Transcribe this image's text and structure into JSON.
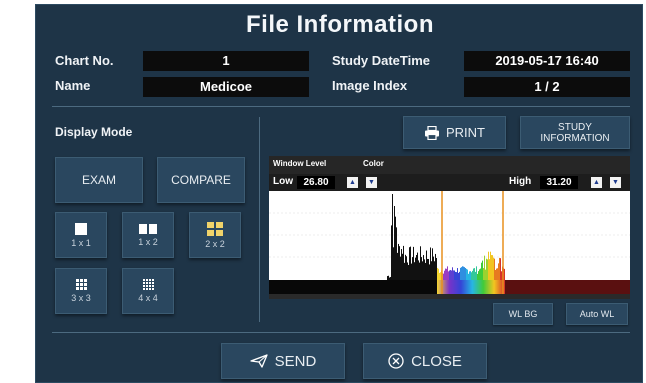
{
  "dialog": {
    "title": "File Information"
  },
  "info": {
    "chart_no_label": "Chart No.",
    "chart_no_value": "1",
    "name_label": "Name",
    "name_value": "Medicoe",
    "study_datetime_label": "Study DateTime",
    "study_datetime_value": "2019-05-17 16:40",
    "image_index_label": "Image Index",
    "image_index_value": "1 / 2"
  },
  "display_mode": {
    "label": "Display Mode",
    "exam_label": "EXAM",
    "compare_label": "COMPARE",
    "layouts": [
      {
        "label": "1 x 1"
      },
      {
        "label": "1 x 2"
      },
      {
        "label": "2 x 2",
        "selected": true
      },
      {
        "label": "3 x 3"
      },
      {
        "label": "4 x 4"
      }
    ]
  },
  "toolbar": {
    "print_label": "PRINT",
    "study_information_line1": "STUDY",
    "study_information_line2": "INFORMATION"
  },
  "histogram": {
    "tabs": [
      "Window Level",
      "Color"
    ],
    "low_label": "Low",
    "low_value": "26.80",
    "high_label": "High",
    "high_value": "31.20",
    "wl_bg_label": "WL BG",
    "auto_wl_label": "Auto WL"
  },
  "footer": {
    "send_label": "SEND",
    "close_label": "CLOSE"
  },
  "colors": {
    "dialog_bg": "#1e3447",
    "button_bg": "#2a475f",
    "marker_orange": "#e8901e",
    "baseline_red": "#5a1010",
    "highlight_yellow": "#f0d36a"
  }
}
